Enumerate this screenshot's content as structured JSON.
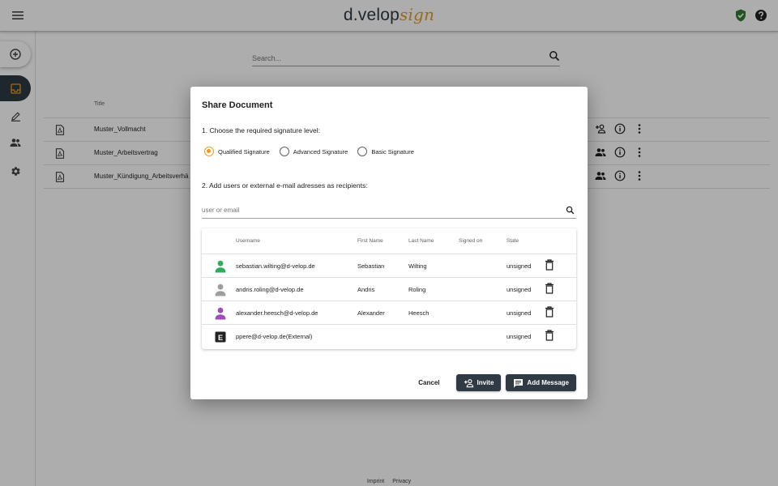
{
  "app": {
    "logo_main": "d.velop",
    "logo_accent": "sign",
    "icons": {
      "menu": "menu-icon",
      "status": "shield-check-icon",
      "help": "help-icon"
    },
    "colors": {
      "primary": "#2f3a45",
      "accent": "#f29a1f",
      "shield": "#2e7d32"
    }
  },
  "sidenav": {
    "items": [
      {
        "name": "add-document",
        "icon": "plus-circle-icon",
        "active": false
      },
      {
        "name": "inbox",
        "icon": "inbox-icon",
        "active": true
      },
      {
        "name": "sign",
        "icon": "pen-icon",
        "active": false
      },
      {
        "name": "users",
        "icon": "users-icon",
        "active": false
      },
      {
        "name": "settings",
        "icon": "gear-icon",
        "active": false
      }
    ]
  },
  "background": {
    "search_placeholder": "Search...",
    "table_header": "Title",
    "documents": [
      {
        "title": "Muster_Vollmacht"
      },
      {
        "title": "Muster_Arbeitsvertrag"
      },
      {
        "title": "Muster_Kündigung_Arbeitsverhä"
      }
    ],
    "footer": {
      "imprint": "Imprint",
      "privacy": "Privacy"
    }
  },
  "dialog": {
    "title": "Share Document",
    "step1": "1. Choose the required signature level:",
    "signature_levels": [
      {
        "label": "Qualified Signature",
        "selected": true
      },
      {
        "label": "Advanced Signature",
        "selected": false
      },
      {
        "label": "Basic Signature",
        "selected": false
      }
    ],
    "step2": "2. Add users or external e-mail adresses as recipients:",
    "recipient_input": {
      "placeholder": "user or email",
      "value": ""
    },
    "columns": {
      "username": "Username",
      "first_name": "First Name",
      "last_name": "Last Name",
      "signed_on": "Signed on",
      "state": "State"
    },
    "recipients": [
      {
        "username": "sebastian.wilting@d-velop.de",
        "first_name": "Sebastian",
        "last_name": "Wilting",
        "signed_on": "",
        "state": "unsigned",
        "avatar_color": "#2eab5b",
        "type": "user"
      },
      {
        "username": "andris.roling@d-velop.de",
        "first_name": "Andris",
        "last_name": "Roling",
        "signed_on": "",
        "state": "unsigned",
        "avatar_color": "#9e9e9e",
        "type": "user"
      },
      {
        "username": "alexander.heesch@d-velop.de",
        "first_name": "Alexander",
        "last_name": "Heesch",
        "signed_on": "",
        "state": "unsigned",
        "avatar_color": "#9c4fb9",
        "type": "user"
      },
      {
        "username": "ppere@d-velop.de(External)",
        "first_name": "",
        "last_name": "",
        "signed_on": "",
        "state": "unsigned",
        "avatar_color": "#212121",
        "type": "external",
        "badge": "E"
      }
    ],
    "buttons": {
      "cancel": "Cancel",
      "invite": "Invite",
      "add_message": "Add Message"
    }
  }
}
